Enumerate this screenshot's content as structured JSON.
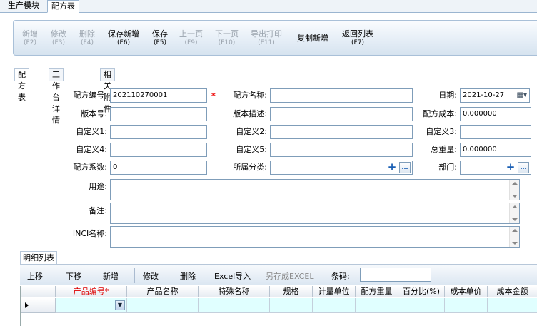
{
  "top_tabs": [
    "生产模块",
    "配方表"
  ],
  "toolbar": [
    {
      "label": "新增",
      "key": "(F2)",
      "enabled": false
    },
    {
      "label": "修改",
      "key": "(F3)",
      "enabled": false
    },
    {
      "label": "删除",
      "key": "(F4)",
      "enabled": false
    },
    {
      "label": "保存新增",
      "key": "(F6)",
      "enabled": true
    },
    {
      "label": "保存",
      "key": "(F5)",
      "enabled": true
    },
    {
      "label": "上一页",
      "key": "(F9)",
      "enabled": false
    },
    {
      "label": "下一页",
      "key": "(F10)",
      "enabled": false
    },
    {
      "label": "导出打印",
      "key": "(F11)",
      "enabled": false
    },
    {
      "label": "复制新增",
      "key": "",
      "enabled": true
    },
    {
      "label": "返回列表",
      "key": "(F7)",
      "enabled": true
    }
  ],
  "form_tabs": [
    "配方表",
    "工作台详情",
    "相关附件"
  ],
  "form": {
    "formula_no_label": "配方编号:",
    "formula_no": "202110270001",
    "required_mark": "*",
    "formula_name_label": "配方名称:",
    "formula_name": "",
    "date_label": "日期:",
    "date": "2021-10-27",
    "version_label": "版本号:",
    "version": "",
    "version_desc_label": "版本描述:",
    "version_desc": "",
    "cost_label": "配方成本:",
    "cost": "0.000000",
    "custom1_label": "自定义1:",
    "custom1": "",
    "custom2_label": "自定义2:",
    "custom2": "",
    "custom3_label": "自定义3:",
    "custom3": "",
    "custom4_label": "自定义4:",
    "custom4": "",
    "custom5_label": "自定义5:",
    "custom5": "",
    "total_weight_label": "总重量:",
    "total_weight": "0.000000",
    "coef_label": "配方系数:",
    "coef": "0",
    "category_label": "所属分类:",
    "category": "",
    "dept_label": "部门:",
    "dept": "",
    "usage_label": "用途:",
    "remark_label": "备注:",
    "inci_label": "INCI名称:"
  },
  "detail": {
    "tab": "明细列表",
    "buttons": [
      "上移",
      "下移",
      "新增",
      "修改",
      "删除",
      "Excel导入",
      "另存成EXCEL"
    ],
    "barcode_label": "条码:",
    "columns": [
      "产品编号*",
      "产品名称",
      "特殊名称",
      "规格",
      "计量单位",
      "配方重量",
      "百分比(%)",
      "成本单价",
      "成本金额"
    ]
  }
}
